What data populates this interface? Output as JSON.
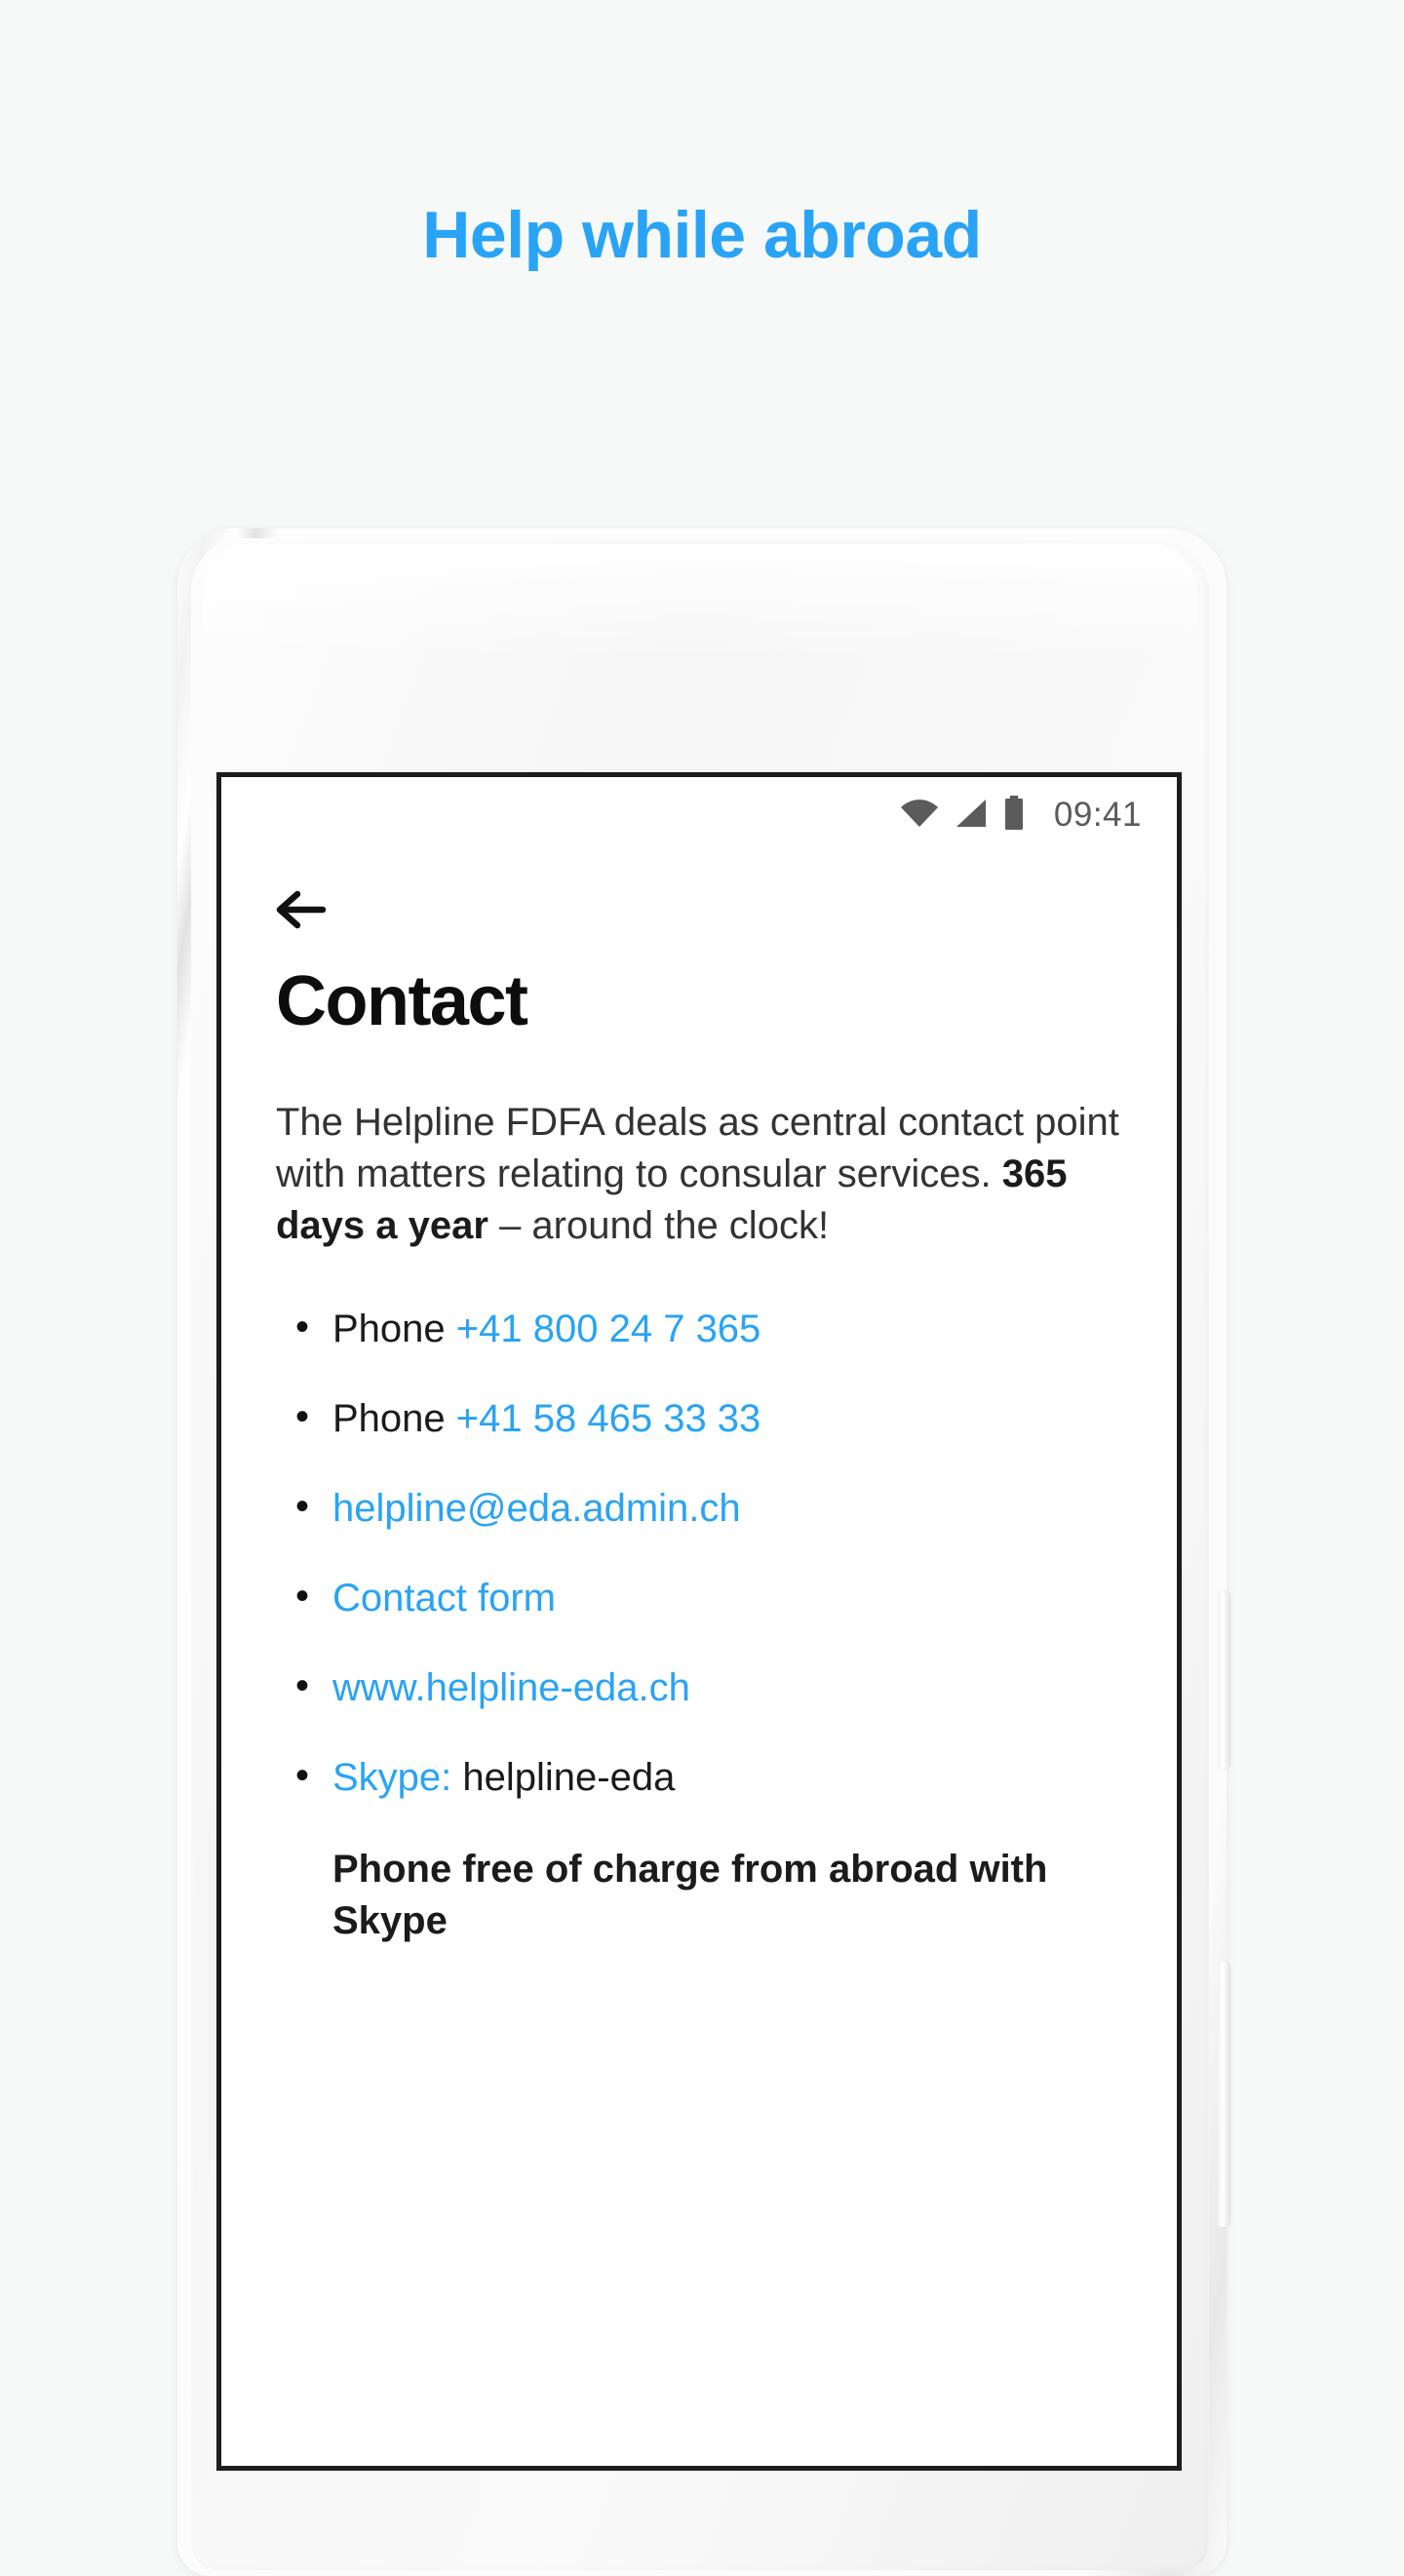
{
  "promo": {
    "title": "Help while abroad",
    "title_color": "#29a3f5"
  },
  "phone": {
    "icons": {
      "front_camera": "camera-icon",
      "earpiece": "speaker-grille-icon",
      "power": "power-button",
      "volume": "volume-button"
    }
  },
  "status_bar": {
    "wifi_icon": "wifi-icon",
    "signal_icon": "cellular-signal-icon",
    "battery_icon": "battery-full-icon",
    "time": "09:41"
  },
  "app": {
    "back_icon": "back-arrow-icon",
    "title": "Contact",
    "intro": {
      "part1": "The Helpline FDFA deals as central contact point with matters relating to consular services. ",
      "bold": "365 days a year",
      "part2": " – around the clock!"
    },
    "contacts": [
      {
        "label": "Phone ",
        "value": "+41 800 24 7 365",
        "value_is_link": true,
        "label_is_link": false
      },
      {
        "label": "Phone ",
        "value": "+41 58 465 33 33",
        "value_is_link": true,
        "label_is_link": false
      },
      {
        "label": "",
        "value": "helpline@eda.admin.ch",
        "value_is_link": true,
        "label_is_link": false
      },
      {
        "label": "",
        "value": "Contact form",
        "value_is_link": true,
        "label_is_link": false
      },
      {
        "label": "",
        "value": "www.helpline-eda.ch",
        "value_is_link": true,
        "label_is_link": false
      },
      {
        "label": "Skype:",
        "value": " helpline-eda",
        "value_is_link": false,
        "label_is_link": true
      }
    ],
    "skype_note": "Phone free of charge from abroad with Skype",
    "link_color": "#29a3f5"
  }
}
